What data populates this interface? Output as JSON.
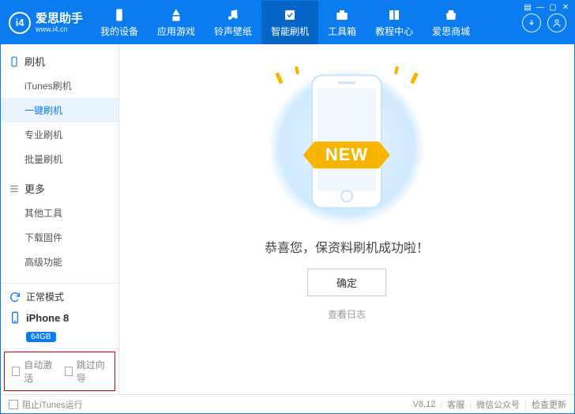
{
  "app": {
    "name": "爱思助手",
    "site": "www.i4.cn",
    "logo_mark": "i4"
  },
  "nav": [
    {
      "id": "device",
      "label": "我的设备"
    },
    {
      "id": "apps",
      "label": "应用游戏"
    },
    {
      "id": "ring",
      "label": "铃声壁纸"
    },
    {
      "id": "flash",
      "label": "智能刷机",
      "active": true
    },
    {
      "id": "tools",
      "label": "工具箱"
    },
    {
      "id": "help",
      "label": "教程中心"
    },
    {
      "id": "mall",
      "label": "爱思商城"
    }
  ],
  "win": {
    "menu": "▤",
    "min": "—",
    "max": "▢",
    "close": "✕"
  },
  "sidebar": {
    "groups": [
      {
        "title": "刷机",
        "icon": "phone",
        "items": [
          {
            "id": "itunes-flash",
            "label": "iTunes刷机"
          },
          {
            "id": "one-key",
            "label": "一键刷机",
            "active": true
          },
          {
            "id": "pro-flash",
            "label": "专业刷机"
          },
          {
            "id": "batch-flash",
            "label": "批量刷机"
          }
        ]
      },
      {
        "title": "更多",
        "icon": "list",
        "items": [
          {
            "id": "other-tools",
            "label": "其他工具"
          },
          {
            "id": "dl-fw",
            "label": "下载固件"
          },
          {
            "id": "advanced",
            "label": "高级功能"
          }
        ]
      }
    ]
  },
  "device": {
    "mode": "正常模式",
    "name": "iPhone 8",
    "storage": "64GB"
  },
  "options": {
    "auto_activate": "自动激活",
    "skip_guide": "跳过向导"
  },
  "main": {
    "banner": "NEW",
    "success_text": "恭喜您，保资料刷机成功啦！",
    "ok": "确定",
    "view_log": "查看日志"
  },
  "status": {
    "block_itunes": "阻止iTunes运行",
    "version": "V8.12",
    "support": "客服",
    "wechat": "微信公众号",
    "check_update": "检查更新"
  }
}
